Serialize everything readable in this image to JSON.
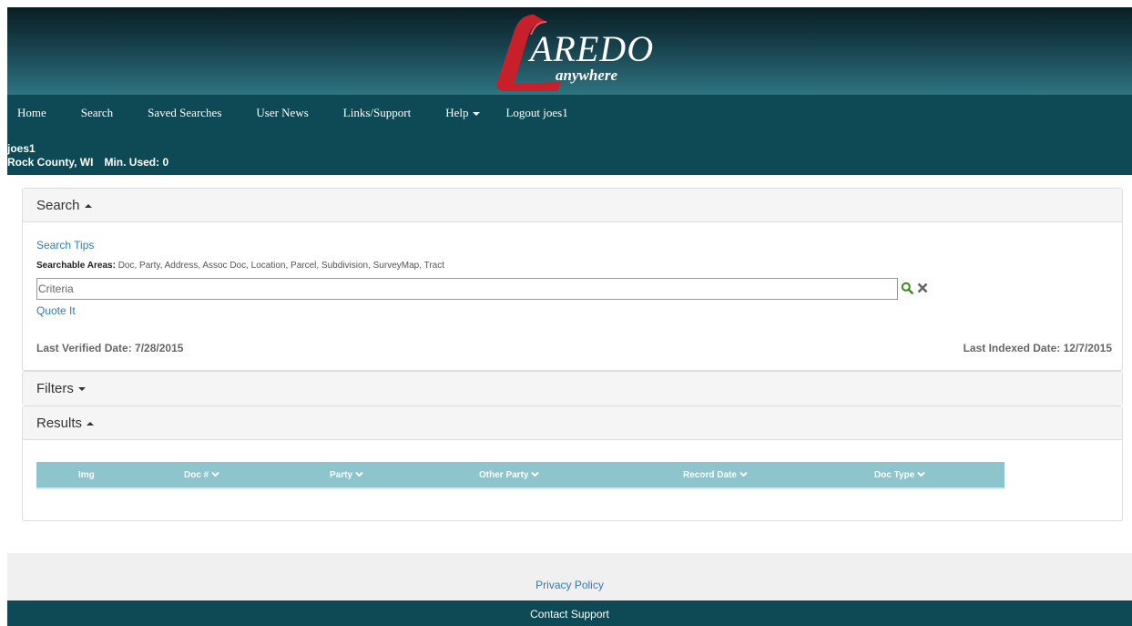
{
  "logo": {
    "brand": "AREDO",
    "tagline": "anywhere"
  },
  "nav": {
    "items": [
      "Home",
      "Search",
      "Saved Searches",
      "User News",
      "Links/Support"
    ],
    "help": "Help",
    "logout": "Logout joes1"
  },
  "user": {
    "name": "joes1",
    "county": "Rock County, WI",
    "minutes": "Min. Used: 0"
  },
  "search_panel": {
    "title": "Search",
    "tips": "Search Tips",
    "areas_label": "Searchable Areas:",
    "areas_list": "Doc, Party, Address, Assoc Doc, Location, Parcel, Subdivision, SurveyMap, Tract",
    "criteria_value": "",
    "criteria_placeholder": "Criteria",
    "quote_it": "Quote It",
    "last_verified": "Last Verified Date: 7/28/2015",
    "last_indexed": "Last Indexed Date: 12/7/2015"
  },
  "filters_panel": {
    "title": "Filters"
  },
  "results_panel": {
    "title": "Results",
    "columns": [
      "Img",
      "Doc #",
      "Party",
      "Other Party",
      "Record Date",
      "Doc Type"
    ]
  },
  "footer": {
    "privacy": "Privacy Policy",
    "contact": "Contact Support"
  },
  "colors": {
    "navbar": "#0e4a56",
    "table_header": "#8ec4cc",
    "link": "#337ab7",
    "logo_red": "#c8202a"
  },
  "icons": {
    "search": "magnifier-icon",
    "clear": "x-icon",
    "sort": "chevron-down-icon"
  }
}
